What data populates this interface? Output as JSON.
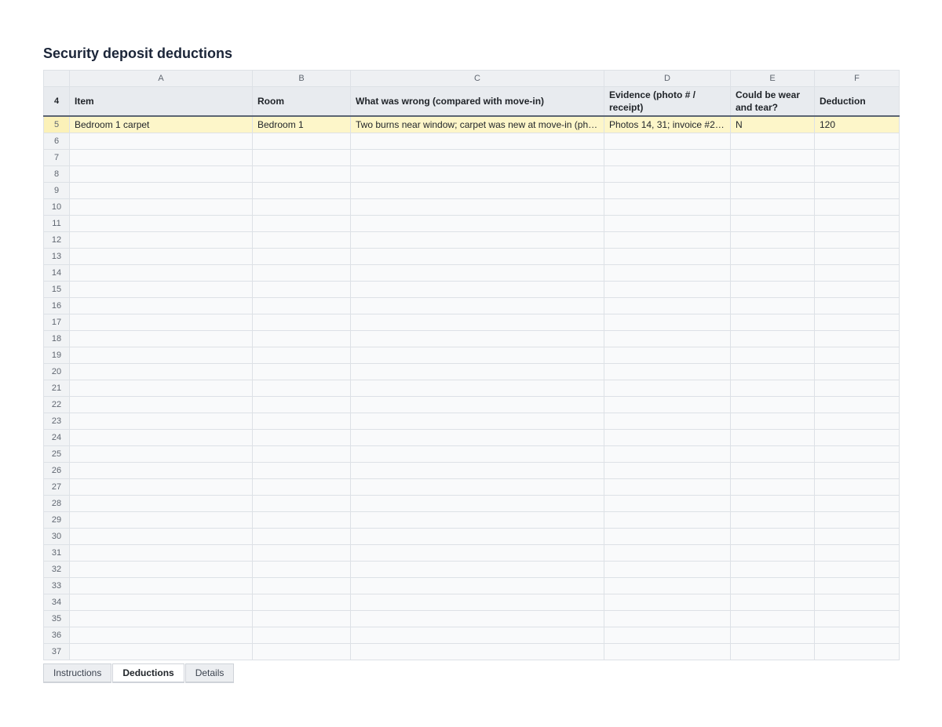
{
  "title": "Security deposit deductions",
  "columns": [
    "A",
    "B",
    "C",
    "D",
    "E",
    "F"
  ],
  "header_row": {
    "row_number": "4",
    "cells": [
      "Item",
      "Room",
      "What was wrong (compared with move-in)",
      "Evidence (photo # / receipt)",
      "Could be wear and tear?",
      "Deduction"
    ]
  },
  "rows": [
    {
      "row_number": "5",
      "cells": [
        "Bedroom 1 carpet",
        "Bedroom 1",
        "Two burns near window; carpet was new at move-in (phot…",
        "Photos 14, 31; invoice #22…",
        "N",
        "120"
      ]
    },
    {
      "row_number": "6",
      "cells": [
        "",
        "",
        "",
        "",
        "",
        ""
      ]
    },
    {
      "row_number": "7",
      "cells": [
        "",
        "",
        "",
        "",
        "",
        ""
      ]
    },
    {
      "row_number": "8",
      "cells": [
        "",
        "",
        "",
        "",
        "",
        ""
      ]
    },
    {
      "row_number": "9",
      "cells": [
        "",
        "",
        "",
        "",
        "",
        ""
      ]
    },
    {
      "row_number": "10",
      "cells": [
        "",
        "",
        "",
        "",
        "",
        ""
      ]
    },
    {
      "row_number": "11",
      "cells": [
        "",
        "",
        "",
        "",
        "",
        ""
      ]
    },
    {
      "row_number": "12",
      "cells": [
        "",
        "",
        "",
        "",
        "",
        ""
      ]
    },
    {
      "row_number": "13",
      "cells": [
        "",
        "",
        "",
        "",
        "",
        ""
      ]
    },
    {
      "row_number": "14",
      "cells": [
        "",
        "",
        "",
        "",
        "",
        ""
      ]
    },
    {
      "row_number": "15",
      "cells": [
        "",
        "",
        "",
        "",
        "",
        ""
      ]
    },
    {
      "row_number": "16",
      "cells": [
        "",
        "",
        "",
        "",
        "",
        ""
      ]
    },
    {
      "row_number": "17",
      "cells": [
        "",
        "",
        "",
        "",
        "",
        ""
      ]
    },
    {
      "row_number": "18",
      "cells": [
        "",
        "",
        "",
        "",
        "",
        ""
      ]
    },
    {
      "row_number": "19",
      "cells": [
        "",
        "",
        "",
        "",
        "",
        ""
      ]
    },
    {
      "row_number": "20",
      "cells": [
        "",
        "",
        "",
        "",
        "",
        ""
      ]
    },
    {
      "row_number": "21",
      "cells": [
        "",
        "",
        "",
        "",
        "",
        ""
      ]
    },
    {
      "row_number": "22",
      "cells": [
        "",
        "",
        "",
        "",
        "",
        ""
      ]
    },
    {
      "row_number": "23",
      "cells": [
        "",
        "",
        "",
        "",
        "",
        ""
      ]
    },
    {
      "row_number": "24",
      "cells": [
        "",
        "",
        "",
        "",
        "",
        ""
      ]
    },
    {
      "row_number": "25",
      "cells": [
        "",
        "",
        "",
        "",
        "",
        ""
      ]
    },
    {
      "row_number": "26",
      "cells": [
        "",
        "",
        "",
        "",
        "",
        ""
      ]
    },
    {
      "row_number": "27",
      "cells": [
        "",
        "",
        "",
        "",
        "",
        ""
      ]
    },
    {
      "row_number": "28",
      "cells": [
        "",
        "",
        "",
        "",
        "",
        ""
      ]
    },
    {
      "row_number": "29",
      "cells": [
        "",
        "",
        "",
        "",
        "",
        ""
      ]
    },
    {
      "row_number": "30",
      "cells": [
        "",
        "",
        "",
        "",
        "",
        ""
      ]
    },
    {
      "row_number": "31",
      "cells": [
        "",
        "",
        "",
        "",
        "",
        ""
      ]
    },
    {
      "row_number": "32",
      "cells": [
        "",
        "",
        "",
        "",
        "",
        ""
      ]
    },
    {
      "row_number": "33",
      "cells": [
        "",
        "",
        "",
        "",
        "",
        ""
      ]
    },
    {
      "row_number": "34",
      "cells": [
        "",
        "",
        "",
        "",
        "",
        ""
      ]
    },
    {
      "row_number": "35",
      "cells": [
        "",
        "",
        "",
        "",
        "",
        ""
      ]
    },
    {
      "row_number": "36",
      "cells": [
        "",
        "",
        "",
        "",
        "",
        ""
      ]
    },
    {
      "row_number": "37",
      "cells": [
        "",
        "",
        "",
        "",
        "",
        ""
      ]
    }
  ],
  "highlighted_row": "5",
  "sheet_tabs": [
    {
      "label": "Instructions",
      "active": false
    },
    {
      "label": "Deductions",
      "active": true
    },
    {
      "label": "Details",
      "active": false
    }
  ],
  "colors": {
    "highlight_row": "#fdf6c9",
    "header_bg": "#e8ebef",
    "title": "#1b2538"
  }
}
